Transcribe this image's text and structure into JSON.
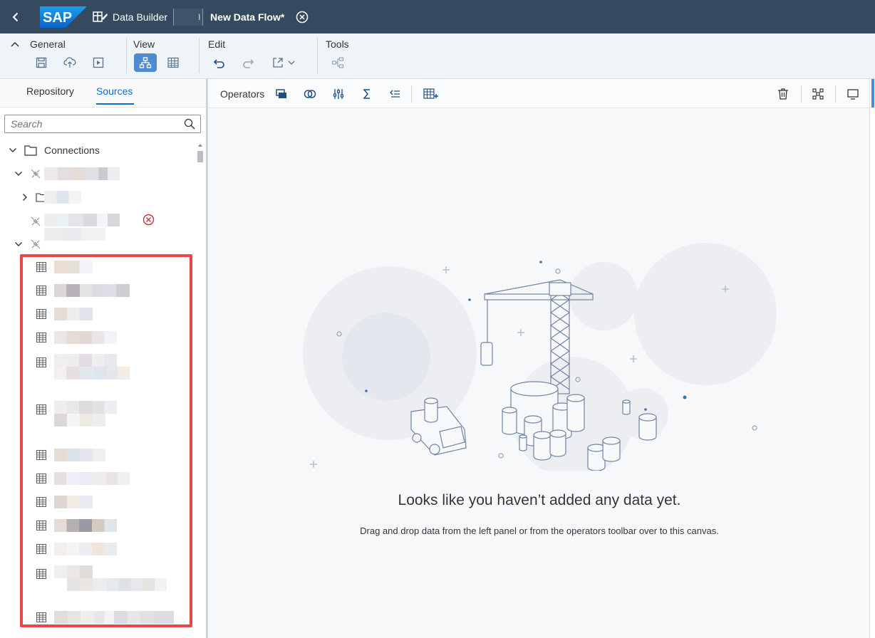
{
  "shell": {
    "back_icon": "back-icon",
    "logo_text": "SAP",
    "app_name": "Data Builder",
    "space_chip_suffix": "l",
    "doc_title": "New Data Flow*",
    "close_icon": "close-circle-icon"
  },
  "toolbar": {
    "general_label": "General",
    "view_label": "View",
    "edit_label": "Edit",
    "tools_label": "Tools",
    "accent": "#4f8bcf"
  },
  "left_panel": {
    "tabs": [
      {
        "label": "Repository"
      },
      {
        "label": "Sources"
      }
    ],
    "search_placeholder": "Search",
    "tree_root": "Connections"
  },
  "canvas": {
    "operators_label": "Operators",
    "empty_title": "Looks like you haven’t added any data yet.",
    "empty_subtitle": "Drag and drop data from the left panel or from the operators toolbar over to this canvas."
  },
  "highlight_color": "#e54848"
}
